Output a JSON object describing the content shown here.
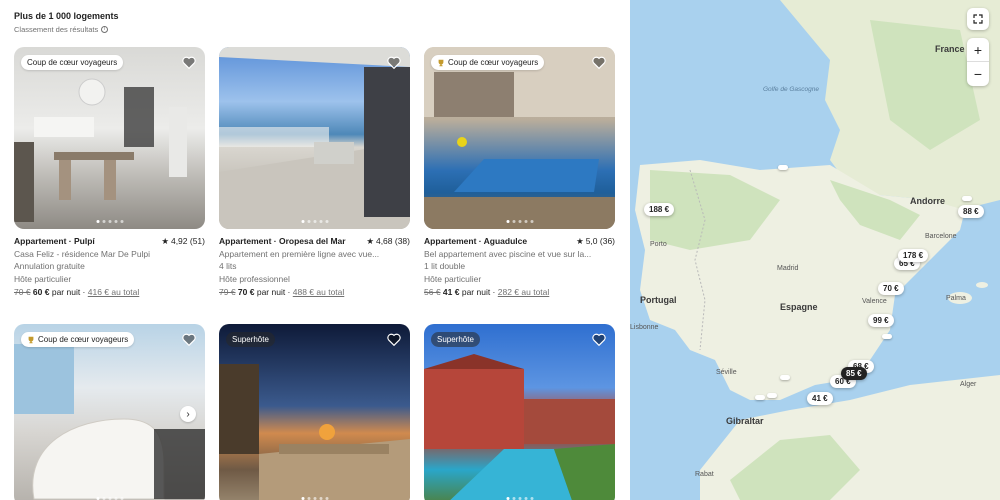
{
  "results": {
    "count_label": "Plus de 1 000 logements",
    "ranking_label": "Classement des résultats"
  },
  "listings": [
    {
      "badge": "Coup de cœur voyageurs",
      "badge_style": "light",
      "title": "Appartement · Pulpí",
      "rating": "4,92 (51)",
      "line1": "Casa Feliz - résidence Mar De Pulpi",
      "line2": "Annulation gratuite",
      "line3": "Hôte particulier",
      "old_price": "70 €",
      "price": "60 €",
      "per_night": "par nuit ·",
      "total": "416 € au total"
    },
    {
      "badge": "",
      "badge_style": "none",
      "title": "Appartement · Oropesa del Mar",
      "rating": "4,68 (38)",
      "line1": "Appartement en première ligne avec vue...",
      "line2": "4 lits",
      "line3": "Hôte professionnel",
      "old_price": "79 €",
      "price": "70 €",
      "per_night": "par nuit ·",
      "total": "488 € au total"
    },
    {
      "badge": "Coup de cœur voyageurs",
      "badge_style": "light",
      "title": "Appartement · Aguadulce",
      "rating": "5,0 (36)",
      "line1": "Bel appartement avec piscine et vue sur la...",
      "line2": "1 lit double",
      "line3": "Hôte particulier",
      "old_price": "56 €",
      "price": "41 €",
      "per_night": "par nuit ·",
      "total": "282 € au total"
    },
    {
      "badge": "Coup de cœur voyageurs",
      "badge_style": "light"
    },
    {
      "badge": "Superhôte",
      "badge_style": "dark"
    },
    {
      "badge": "Superhôte",
      "badge_style": "dark"
    }
  ],
  "map": {
    "labels": {
      "france": "France",
      "golfe": "Golfe de Gascogne",
      "andorre": "Andorre",
      "porto": "Porto",
      "portugal": "Portugal",
      "madrid": "Madrid",
      "espagne": "Espagne",
      "barcelone": "Barcelone",
      "valence": "Valence",
      "palma": "Palma",
      "lisbonne": "Lisbonne",
      "seville": "Séville",
      "gibraltar": "Gibraltar",
      "alger": "Alger",
      "rabat": "Rabat"
    },
    "pins": {
      "p188": "188 €",
      "p88": "88 €",
      "p178": "178 €",
      "p65": "65 €",
      "p70": "70 €",
      "p99": "99 €",
      "p60": "60 €",
      "p85": "85 €",
      "p68": "68 €",
      "p41": "41 €"
    },
    "zoom_in": "+",
    "zoom_out": "−",
    "colors": {
      "land": "#eef0e2",
      "land_green": "#cfe3bd",
      "water": "#a9d1ee",
      "active_pin": "#222222"
    }
  }
}
